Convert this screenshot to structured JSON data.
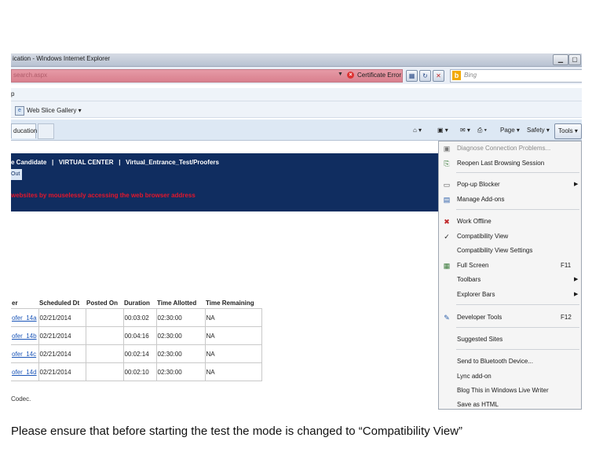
{
  "window": {
    "title": "ication - Windows Internet Explorer"
  },
  "address_bar": {
    "url": "search.aspx",
    "certificate_error": "Certificate Error",
    "search_placeholder": "Bing"
  },
  "menu_bar": {
    "visible_text": "p"
  },
  "favorites_bar": {
    "web_slice_gallery": "Web Slice Gallery ▾"
  },
  "tabs": {
    "active_tab": "ducation"
  },
  "command_bar": {
    "page": "Page ▾",
    "safety": "Safety ▾",
    "tools": "Tools ▾"
  },
  "page": {
    "breadcrumb": "e Candidate   |   VIRTUAL CENTER   |   Virtual_Entrance_Test/Proofers",
    "logout": "Out",
    "warning": "websites by mouselessly accessing the web browser address",
    "table": {
      "headers": [
        "er",
        "Scheduled Dt",
        "Posted On",
        "Duration",
        "Time Allotted",
        "Time Remaining"
      ],
      "rows": [
        {
          "test": "ofer_14a",
          "scheduled": "02/21/2014",
          "posted": "",
          "duration": "00:03:02",
          "allotted": "02:30:00",
          "remaining": "NA"
        },
        {
          "test": "ofer_14b",
          "scheduled": "02/21/2014",
          "posted": "",
          "duration": "00:04:16",
          "allotted": "02:30:00",
          "remaining": "NA"
        },
        {
          "test": "ofer_14c",
          "scheduled": "02/21/2014",
          "posted": "",
          "duration": "00:02:14",
          "allotted": "02:30:00",
          "remaining": "NA"
        },
        {
          "test": "ofer_14d",
          "scheduled": "02/21/2014",
          "posted": "",
          "duration": "00:02:10",
          "allotted": "02:30:00",
          "remaining": "NA"
        }
      ]
    },
    "footnote": "Codec."
  },
  "tools_menu": {
    "items": [
      {
        "label": "Diagnose Connection Problems...",
        "disabled": true,
        "icon": "diagnose-icon"
      },
      {
        "label": "Reopen Last Browsing Session",
        "icon": "reopen-session-icon"
      },
      {
        "label": "Pop-up Blocker",
        "submenu": true,
        "icon": "popup-blocker-icon"
      },
      {
        "label": "Manage Add-ons",
        "icon": "addons-icon"
      },
      {
        "label": "Work Offline",
        "icon": "work-offline-icon"
      },
      {
        "label": "Compatibility View",
        "checked": true
      },
      {
        "label": "Compatibility View Settings"
      },
      {
        "label": "Full Screen",
        "shortcut": "F11",
        "icon": "fullscreen-icon"
      },
      {
        "label": "Toolbars",
        "submenu": true
      },
      {
        "label": "Explorer Bars",
        "submenu": true
      },
      {
        "label": "Developer Tools",
        "shortcut": "F12",
        "icon": "developer-tools-icon"
      },
      {
        "label": "Suggested Sites"
      },
      {
        "label": "Send to Bluetooth Device..."
      },
      {
        "label": "Lync add-on"
      },
      {
        "label": "Blog This in Windows Live Writer"
      },
      {
        "label": "Save as HTML"
      }
    ]
  },
  "caption": "Please ensure that before starting the test the mode is changed to “Compatibility View”"
}
